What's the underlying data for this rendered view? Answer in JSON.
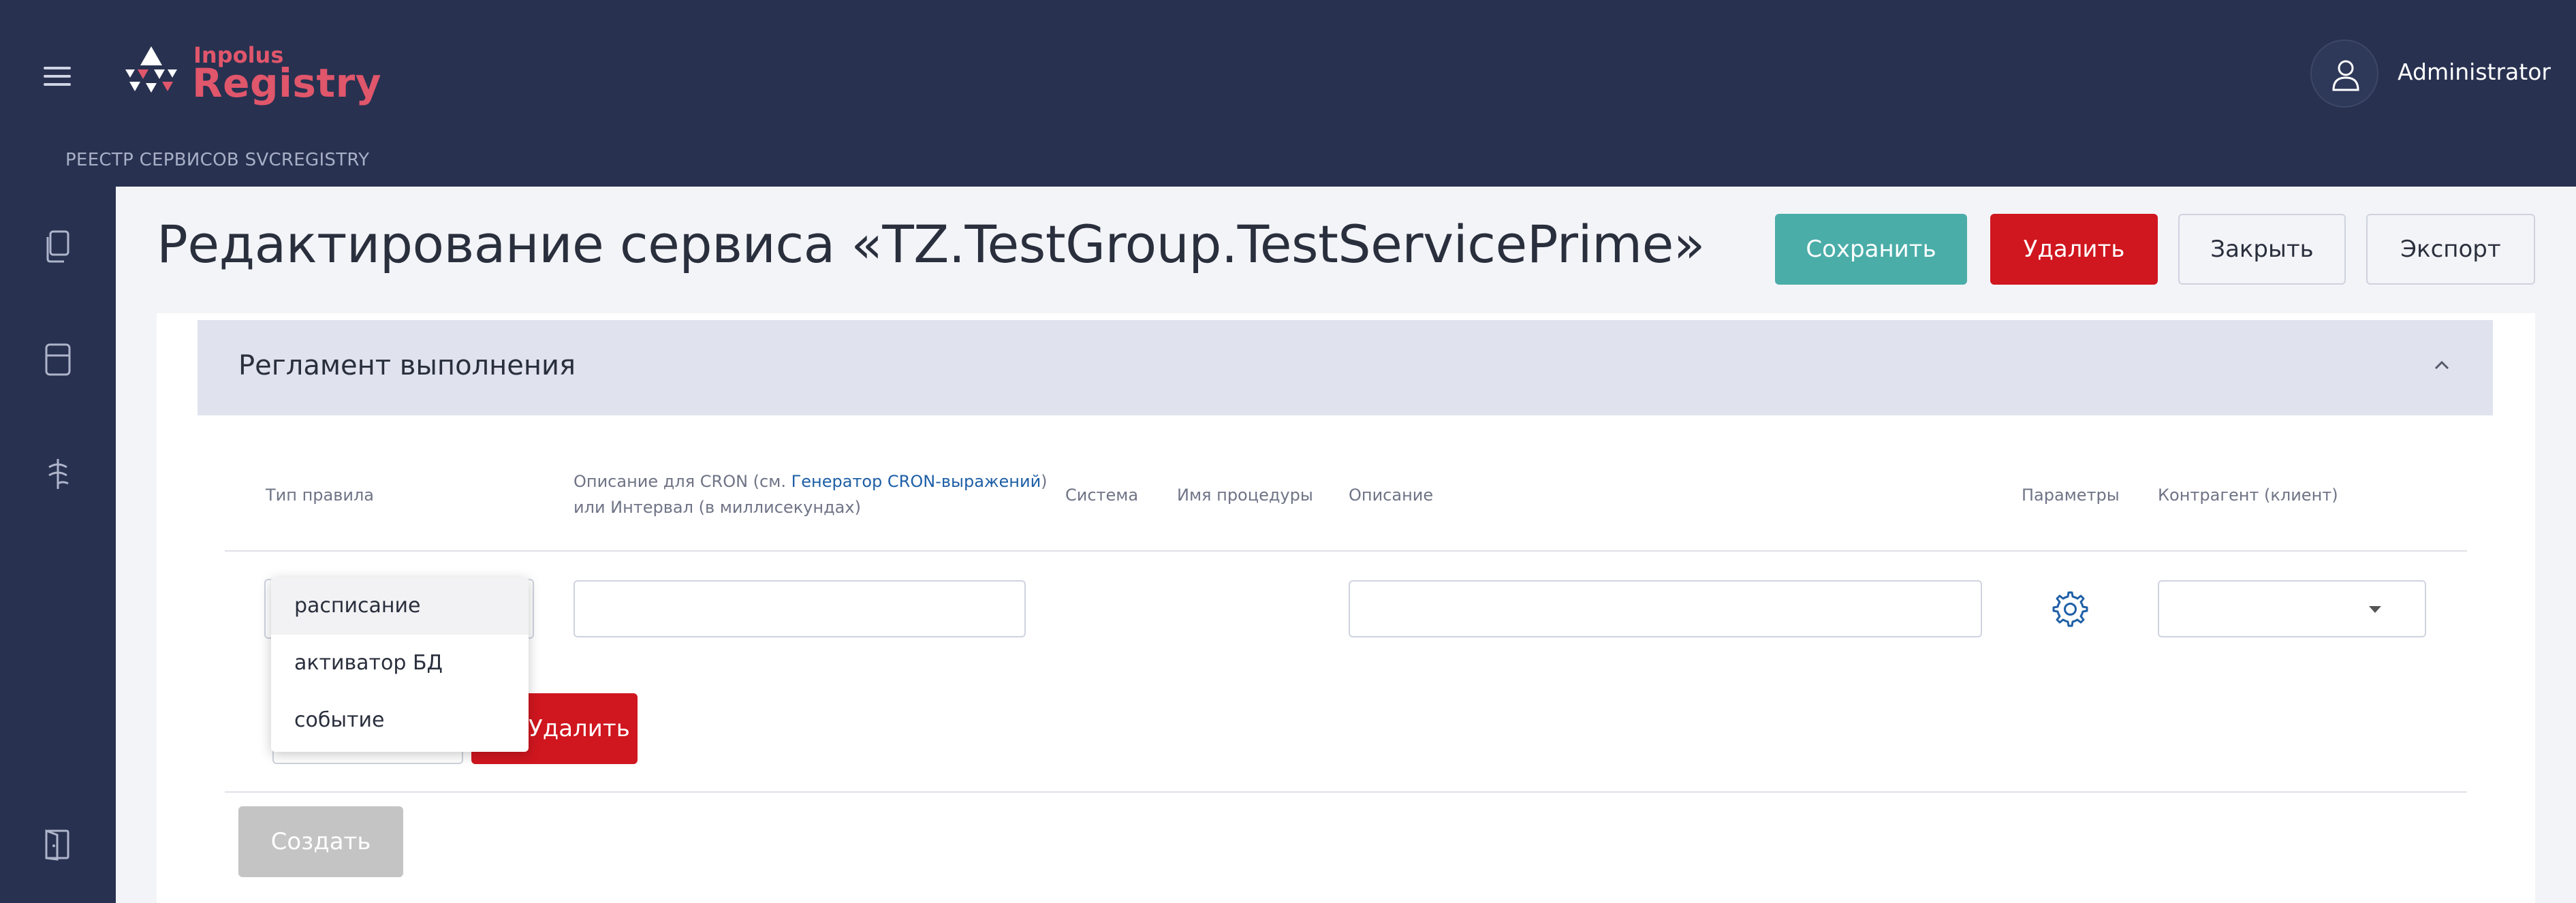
{
  "header": {
    "brand_small": "Inpolus",
    "brand_big": "Registry",
    "breadcrumb": "РЕЕСТР СЕРВИСОВ SVCREGISTRY",
    "user_name": "Administrator"
  },
  "sidebar": {
    "items": [
      {
        "icon": "copy-icon"
      },
      {
        "icon": "server-icon"
      },
      {
        "icon": "stack-icon"
      },
      {
        "icon": "logout-icon"
      }
    ]
  },
  "page": {
    "title": "Редактирование сервиса «TZ.TestGroup.TestServicePrime»"
  },
  "toolbar": {
    "save_label": "Сохранить",
    "delete_label": "Удалить",
    "close_label": "Закрыть",
    "export_label": "Экспорт"
  },
  "section": {
    "title": "Регламент выполнения"
  },
  "table": {
    "headers": {
      "rule_type": "Тип правила",
      "cron_prefix": "Описание для CRON (см. ",
      "cron_link": "Генератор CRON-выражений",
      "cron_suffix": ")",
      "cron_line2": "или Интервал (в миллисекундах)",
      "system": "Система",
      "procedure": "Имя процедуры",
      "description": "Описание",
      "params": "Параметры",
      "client": "Контрагент (клиент)"
    },
    "row": {
      "cron_value": "",
      "description_value": "",
      "client_value": "",
      "delete_label": "Удалить"
    }
  },
  "dropdown": {
    "options": [
      "расписание",
      "активатор БД",
      "событие"
    ],
    "highlighted": "расписание"
  },
  "actions": {
    "create_label": "Создать"
  },
  "colors": {
    "header_bg": "#283150",
    "accent_teal": "#4aada8",
    "danger": "#d0161f",
    "brand": "#e0566b",
    "link": "#1e5fa6"
  }
}
